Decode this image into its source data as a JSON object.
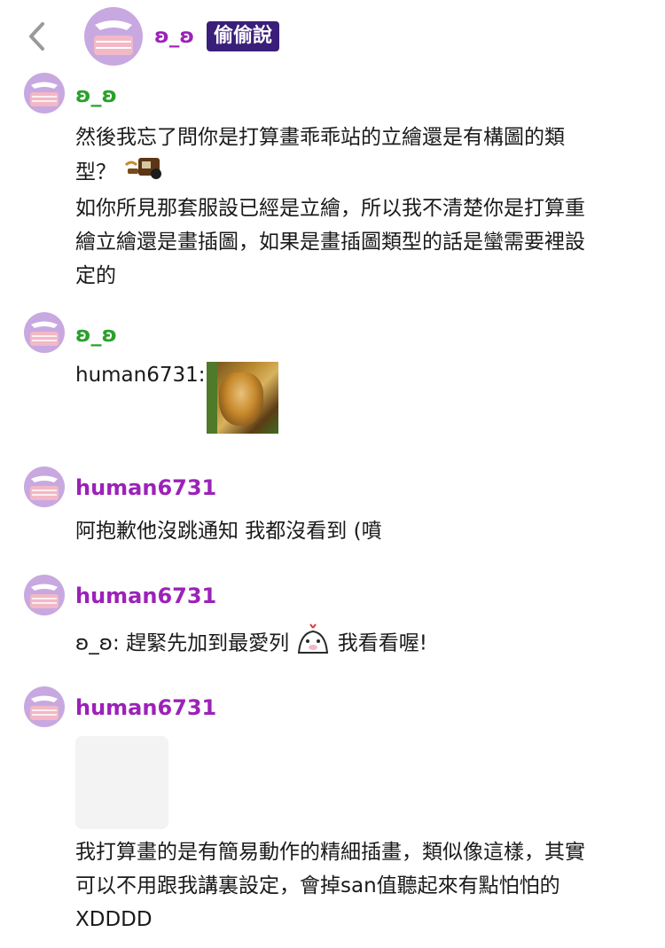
{
  "header": {
    "name": "ʚ̴̶̷̷ɞ",
    "name_display": "ʚ_ʚ",
    "badge": "偷偷說"
  },
  "messages": [
    {
      "username": "ʚ_ʚ",
      "lines": [
        "然後我忘了問你是打算畫乖乖站的立繪還是有構圖的類",
        "型？",
        "如你所見那套服設已經是立繪，所以我不清楚你是打算重",
        "繪立繪還是畫插圖，如果是畫插圖類型的話是蠻需要裡設",
        "定的"
      ]
    },
    {
      "username": "ʚ_ʚ",
      "reply_prefix": "human6731:"
    },
    {
      "username": "human6731",
      "text": "阿抱歉他沒跳通知 我都沒看到 (噴"
    },
    {
      "username": "human6731",
      "text_before": "ʚ_ʚ: 趕緊先加到最愛列",
      "text_after": "我看看喔!"
    },
    {
      "username": "human6731",
      "lines": [
        "我打算畫的是有簡易動作的精細插畫，類似像這樣，其實",
        "可以不用跟我講裏設定，會掉san值聽起來有點怕怕的",
        "XDDDD"
      ]
    }
  ],
  "colors": {
    "purple_name": "#9b22b8",
    "green_name": "#2aa12a",
    "badge_bg": "#3a1f7a",
    "avatar_bg": "#c8a8e0",
    "mask": "#f2b8c6"
  }
}
